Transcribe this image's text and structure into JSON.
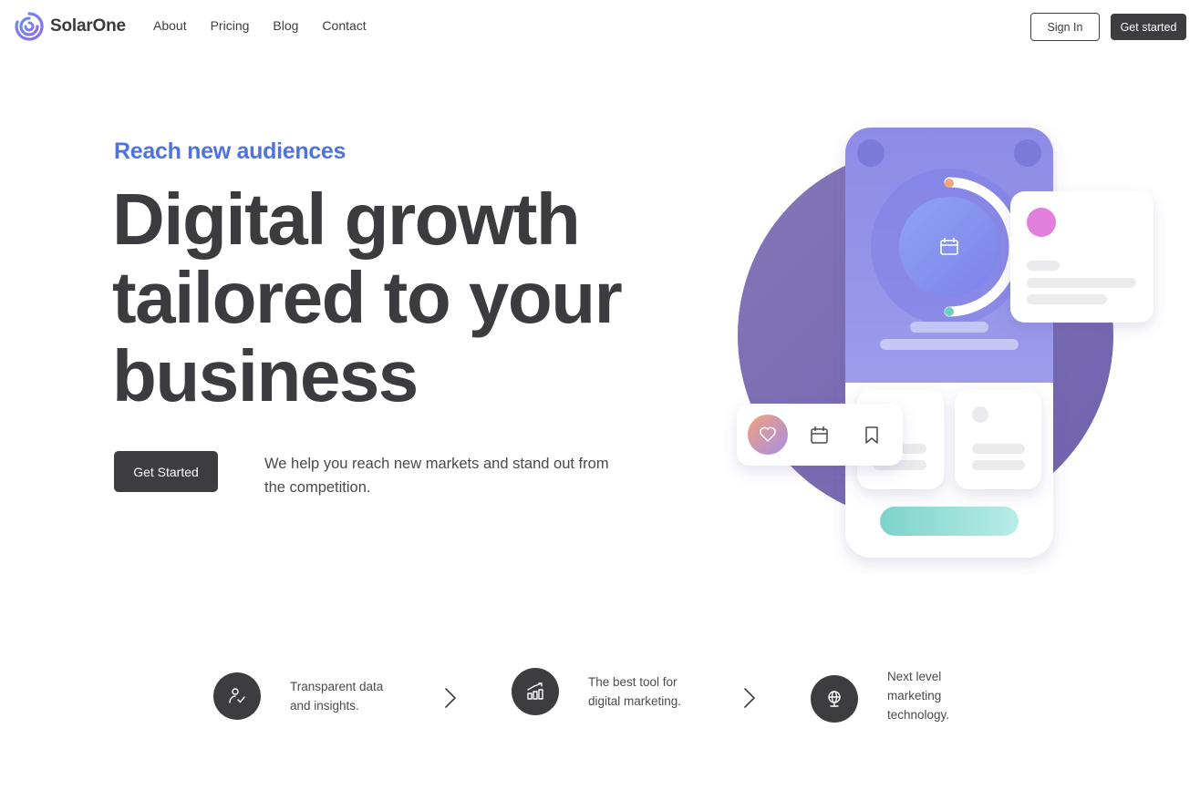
{
  "brand": {
    "name": "SolarOne",
    "logo_icon": "swirl-logo-icon",
    "accent": "#4e73df"
  },
  "nav": {
    "links": [
      "About",
      "Pricing",
      "Blog",
      "Contact"
    ],
    "sign_in": "Sign In",
    "get_started": "Get started"
  },
  "hero": {
    "eyebrow": "Reach new audiences",
    "headline": [
      "Digital growth",
      "tailored to your",
      "business"
    ],
    "cta": "Get Started",
    "description": "We help you reach new markets and stand out from the competition."
  },
  "features": [
    {
      "icon": "user-check-icon",
      "text": "Transparent data and insights."
    },
    {
      "icon": "bar-chart-growth-icon",
      "text": "The best tool for digital marketing."
    },
    {
      "icon": "globe-icon",
      "text": "Next level marketing technology."
    }
  ],
  "colors": {
    "dark": "#3d3d40",
    "purple": "#8b84e6",
    "violet_circle": "#7d6fb4",
    "teal": "#7fd6cf",
    "pink": "#e07fdc"
  }
}
